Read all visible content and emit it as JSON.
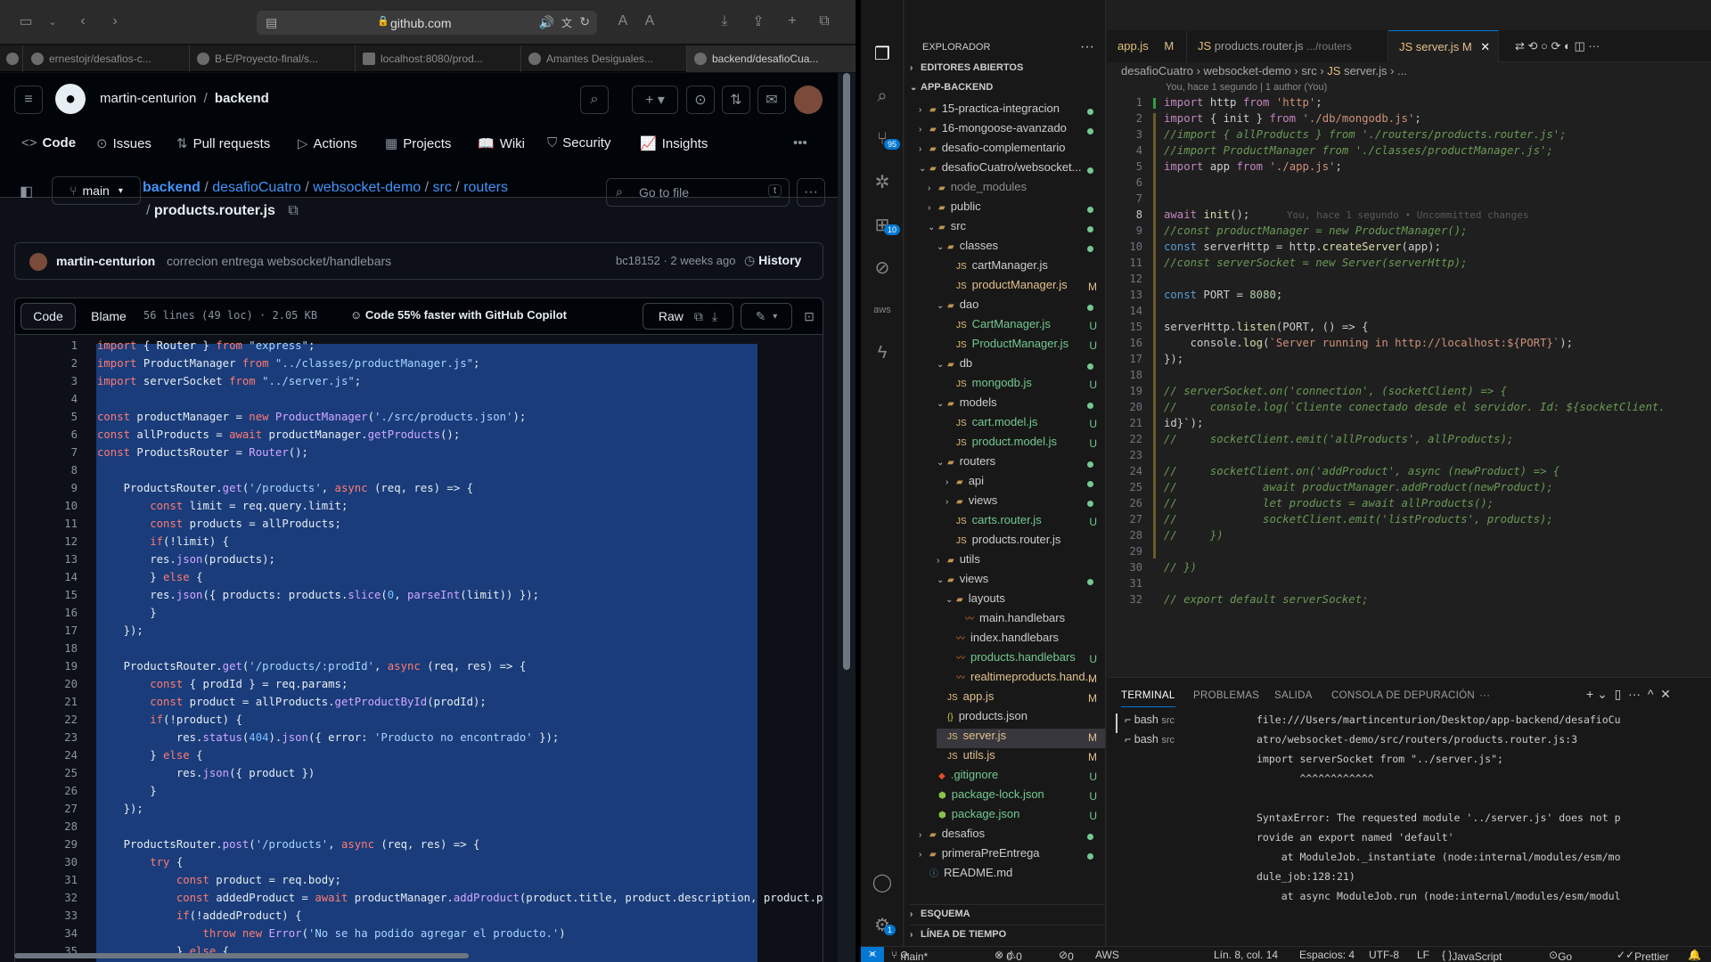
{
  "browser": {
    "url": "github.com",
    "tabs": [
      "ernestojr/desafios-c...",
      "B-E/Proyecto-final/s...",
      "localhost:8080/prod...",
      "Amantes Desiguales...",
      "backend/desafioCua..."
    ]
  },
  "gh": {
    "owner": "martin-centurion",
    "repo": "backend",
    "nav": [
      "Code",
      "Issues",
      "Pull requests",
      "Actions",
      "Projects",
      "Wiki",
      "Security",
      "Insights"
    ],
    "branch": "main",
    "crumbs": [
      "backend",
      "desafioCuatro",
      "websocket-demo",
      "src",
      "routers"
    ],
    "file": "products.router.js",
    "goto": "Go to file",
    "goto_key": "t",
    "author": "martin-centurion",
    "commit_msg": "correcion entrega websocket/handlebars",
    "commit": "bc18152 · 2 weeks ago",
    "history": "History",
    "code_tab": "Code",
    "blame_tab": "Blame",
    "info": "56 lines (49 loc) · 2.05 KB",
    "copilot": "Code 55% faster with GitHub Copilot",
    "raw": "Raw"
  },
  "gh_code": [
    "import { Router } from \"express\";",
    "import ProductManager from \"../classes/productManager.js\";",
    "import serverSocket from \"../server.js\";",
    "",
    "const productManager = new ProductManager('./src/products.json');",
    "const allProducts = await productManager.getProducts();",
    "const ProductsRouter = Router();",
    "",
    "    ProductsRouter.get('/products', async (req, res) => {",
    "        const limit = req.query.limit;",
    "        const products = allProducts;",
    "        if(!limit) {",
    "        res.json(products);",
    "        } else {",
    "        res.json({ products: products.slice(0, parseInt(limit)) });",
    "        }",
    "    });",
    "",
    "    ProductsRouter.get('/products/:prodId', async (req, res) => {",
    "        const { prodId } = req.params;",
    "        const product = allProducts.getProductById(prodId);",
    "        if(!product) {",
    "            res.status(404).json({ error: 'Producto no encontrado' });",
    "        } else {",
    "            res.json({ product })",
    "        }",
    "    });",
    "",
    "    ProductsRouter.post('/products', async (req, res) => {",
    "        try {",
    "            const product = req.body;",
    "            const addedProduct = await productManager.addProduct(product.title, product.description, product.p",
    "            if(!addedProduct) {",
    "                throw new Error('No se ha podido agregar el producto.')",
    "            } else {"
  ],
  "vs": {
    "search": "app-backend",
    "explorer": "EXPLORADOR",
    "open_editors": "EDITORES ABIERTOS",
    "root": "APP-BACKEND",
    "tree": [
      {
        "d": 1,
        "t": "c",
        "n": "15-practica-integracion",
        "s": "dot"
      },
      {
        "d": 1,
        "t": "c",
        "n": "16-mongoose-avanzado",
        "s": "dot"
      },
      {
        "d": 1,
        "t": "c",
        "n": "desafio-complementario",
        "s": ""
      },
      {
        "d": 1,
        "t": "o",
        "n": "desafioCuatro/websocket...",
        "s": "dot"
      },
      {
        "d": 2,
        "t": "c",
        "n": "node_modules",
        "s": "",
        "g": 1
      },
      {
        "d": 2,
        "t": "c",
        "n": "public",
        "s": "dot"
      },
      {
        "d": 2,
        "t": "o",
        "n": "src",
        "s": "dot"
      },
      {
        "d": 3,
        "t": "o",
        "n": "classes",
        "s": "dot"
      },
      {
        "d": 4,
        "t": "f",
        "n": "cartManager.js",
        "s": ""
      },
      {
        "d": 4,
        "t": "f",
        "n": "productManager.js",
        "s": "M"
      },
      {
        "d": 3,
        "t": "o",
        "n": "dao",
        "s": "dot"
      },
      {
        "d": 4,
        "t": "f",
        "n": "CartManager.js",
        "s": "U"
      },
      {
        "d": 4,
        "t": "f",
        "n": "ProductManager.js",
        "s": "U"
      },
      {
        "d": 3,
        "t": "o",
        "n": "db",
        "s": "dot"
      },
      {
        "d": 4,
        "t": "f",
        "n": "mongodb.js",
        "s": "U"
      },
      {
        "d": 3,
        "t": "o",
        "n": "models",
        "s": "dot"
      },
      {
        "d": 4,
        "t": "f",
        "n": "cart.model.js",
        "s": "U"
      },
      {
        "d": 4,
        "t": "f",
        "n": "product.model.js",
        "s": "U"
      },
      {
        "d": 3,
        "t": "o",
        "n": "routers",
        "s": "dot"
      },
      {
        "d": 4,
        "t": "c",
        "n": "api",
        "s": "dot"
      },
      {
        "d": 4,
        "t": "c",
        "n": "views",
        "s": "dot"
      },
      {
        "d": 4,
        "t": "f",
        "n": "carts.router.js",
        "s": "U"
      },
      {
        "d": 4,
        "t": "f",
        "n": "products.router.js",
        "s": ""
      },
      {
        "d": 3,
        "t": "c",
        "n": "utils",
        "s": ""
      },
      {
        "d": 3,
        "t": "o",
        "n": "views",
        "s": "dot"
      },
      {
        "d": 4,
        "t": "o",
        "n": "layouts",
        "s": ""
      },
      {
        "d": 5,
        "t": "h",
        "n": "main.handlebars",
        "s": ""
      },
      {
        "d": 4,
        "t": "h",
        "n": "index.handlebars",
        "s": ""
      },
      {
        "d": 4,
        "t": "h",
        "n": "products.handlebars",
        "s": "U"
      },
      {
        "d": 4,
        "t": "h",
        "n": "realtimeproducts.hand...",
        "s": "M"
      },
      {
        "d": 3,
        "t": "f",
        "n": "app.js",
        "s": "M"
      },
      {
        "d": 3,
        "t": "j",
        "n": "products.json",
        "s": ""
      },
      {
        "d": 3,
        "t": "f",
        "n": "server.js",
        "s": "M",
        "sel": 1
      },
      {
        "d": 3,
        "t": "f",
        "n": "utils.js",
        "s": "M"
      },
      {
        "d": 2,
        "t": "g",
        "n": ".gitignore",
        "s": "U"
      },
      {
        "d": 2,
        "t": "p",
        "n": "package-lock.json",
        "s": "U"
      },
      {
        "d": 2,
        "t": "p",
        "n": "package.json",
        "s": "U"
      },
      {
        "d": 1,
        "t": "c",
        "n": "desafios",
        "s": "dot"
      },
      {
        "d": 1,
        "t": "c",
        "n": "primeraPreEntrega",
        "s": "dot"
      },
      {
        "d": 1,
        "t": "i",
        "n": "README.md",
        "s": ""
      }
    ],
    "outline": "ESQUEMA",
    "timeline": "LÍNEA DE TIEMPO",
    "tabs": [
      {
        "n": "app.js",
        "m": "M"
      },
      {
        "n": "products.router.js",
        "m": ".../routers"
      },
      {
        "n": "server.js",
        "m": "M"
      }
    ],
    "bc": [
      "desafioCuatro",
      "websocket-demo",
      "src",
      "server.js",
      "..."
    ],
    "blame": "You, hace 1 segundo | 1 author (You)",
    "inline": "You, hace 1 segundo • Uncommitted changes",
    "panel_tabs": [
      "TERMINAL",
      "PROBLEMAS",
      "SALIDA",
      "CONSOLA DE DEPURACIÓN"
    ],
    "terms": [
      "bash",
      "bash"
    ],
    "term_sub": "src",
    "term": [
      "file:///Users/martincenturion/Desktop/app-backend/desafioCu",
      "atro/websocket-demo/src/routers/products.router.js:3",
      "import serverSocket from \"../server.js\";",
      "       ^^^^^^^^^^^^",
      "",
      "SyntaxError: The requested module '../server.js' does not p",
      "rovide an export named 'default'",
      "    at ModuleJob._instantiate (node:internal/modules/esm/mo",
      "dule_job:128:21)",
      "    at async ModuleJob.run (node:internal/modules/esm/modul"
    ],
    "status": {
      "branch": "main*",
      "errs": "0",
      "warns": "0",
      "ports": "0",
      "aws": "AWS",
      "pos": "Lín. 8, col. 14",
      "spaces": "Espacios: 4",
      "enc": "UTF-8",
      "eol": "LF",
      "lang": "JavaScript",
      "live": "Go Live",
      "prettier": "Prettier"
    },
    "badges": {
      "scm": "95",
      "ext": "10",
      "acc": "1"
    }
  },
  "vs_code": [
    "import http from 'http';",
    "import { init } from './db/mongodb.js';",
    "//import { allProducts } from './routers/products.router.js';",
    "//import ProductManager from './classes/productManager.js';",
    "import app from './app.js';",
    "",
    "",
    "await init();",
    "//const productManager = new ProductManager();",
    "const serverHttp = http.createServer(app);",
    "//const serverSocket = new Server(serverHttp);",
    "",
    "const PORT = 8080;",
    "",
    "serverHttp.listen(PORT, () => {",
    "    console.log(`Server running in http://localhost:${PORT}`);",
    "});",
    "",
    "// serverSocket.on('connection', (socketClient) => {",
    "//     console.log(`Cliente conectado desde el servidor. Id: ${socketClient.",
    "id}`);",
    "//     socketClient.emit('allProducts', allProducts);",
    "",
    "//     socketClient.on('addProduct', async (newProduct) => {",
    "//             await productManager.addProduct(newProduct);",
    "//             let products = await allProducts();",
    "//             socketClient.emit('listProducts', products);",
    "//     })",
    "",
    "// })",
    "",
    "// export default serverSocket;"
  ],
  "colors": {
    "gh_bg": "#0d1117",
    "gh_sel": "#1a3c7a",
    "vs_bg": "#1f1f1f",
    "accent": "#0078d4"
  }
}
